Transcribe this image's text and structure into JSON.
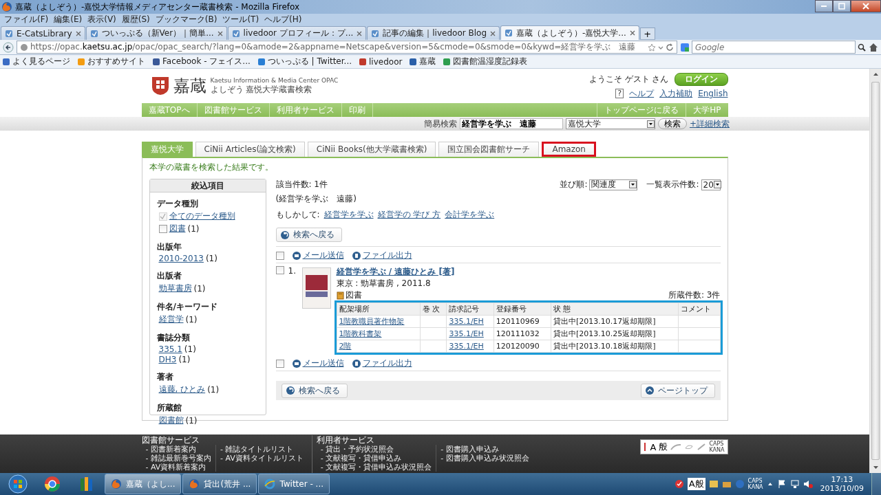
{
  "browser": {
    "title": "嘉蔵（よしぞう）-嘉悦大学情報メディアセンター蔵書検索 - Mozilla Firefox",
    "menu": [
      "ファイル(F)",
      "編集(E)",
      "表示(V)",
      "履歴(S)",
      "ブックマーク(B)",
      "ツール(T)",
      "ヘルプ(H)"
    ],
    "tabs": [
      {
        "label": "E-CatsLibrary",
        "selected": false
      },
      {
        "label": "ついっぷる（新Ver）｜簡単...",
        "selected": false
      },
      {
        "label": "livedoor プロフィール：プ...",
        "selected": false
      },
      {
        "label": "記事の編集｜livedoor Blog",
        "selected": false
      },
      {
        "label": "嘉蔵（よしぞう）-嘉悦大学...",
        "selected": true
      }
    ],
    "new_tab": "+",
    "url_prefix": "https://opac.",
    "url_domain": "kaetsu.ac.jp",
    "url_rest": "/opac/opac_search/?lang=0&amode=2&appname=Netscape&version=5&cmode=0&smode=0&kywd=経営学を学ぶ　遠藤",
    "search_placeholder": "Google",
    "bookmarks": [
      "よく見るページ",
      "おすすめサイト",
      "Facebook - フェイス...",
      "ついっぷる | Twitter...",
      "livedoor",
      "嘉蔵",
      "図書館温湿度記録表"
    ]
  },
  "site": {
    "logo": "嘉蔵",
    "subtitle_en": "Kaetsu Information & Media Center OPAC",
    "subtitle": "よしぞう 嘉悦大学蔵書検索",
    "welcome": "ようこそ ゲスト さん",
    "login": "ログイン",
    "help_icon": "?",
    "links": [
      "ヘルプ",
      "入力補助",
      "English"
    ],
    "nav_left": [
      "嘉蔵TOPへ",
      "図書館サービス",
      "利用者サービス",
      "印刷"
    ],
    "nav_right": [
      "トップページに戻る",
      "大学HP"
    ],
    "quick_search": {
      "label": "簡易検索",
      "value": "経営学を学ぶ　遠藤",
      "scope": "嘉悦大学",
      "button": "検索",
      "advanced": "+詳細検索"
    },
    "source_tabs": [
      {
        "label": "嘉悦大学",
        "selected": true,
        "highlighted": false
      },
      {
        "label": "CiNii Articles(論文検索)",
        "selected": false,
        "highlighted": false
      },
      {
        "label": "CiNii Books(他大学蔵書検索)",
        "selected": false,
        "highlighted": false
      },
      {
        "label": "国立国会図書館サーチ",
        "selected": false,
        "highlighted": false
      },
      {
        "label": "Amazon",
        "selected": false,
        "highlighted": true
      }
    ],
    "intro": "本学の蔵書を検索した結果です。",
    "facets": {
      "title": "絞込項目",
      "groups": [
        {
          "heading": "データ種別",
          "items": [
            {
              "kind": "checkbox",
              "label": "全てのデータ種別",
              "checked": true,
              "disabled": true
            },
            {
              "kind": "checkbox",
              "label": "図書",
              "count": "(1)",
              "checked": false,
              "disabled": false
            }
          ]
        },
        {
          "heading": "出版年",
          "items": [
            {
              "kind": "link",
              "label": "2010-2013",
              "count": "(1)"
            }
          ]
        },
        {
          "heading": "出版者",
          "items": [
            {
              "kind": "link",
              "label": "勁草書房",
              "count": "(1)"
            }
          ]
        },
        {
          "heading": "件名/キーワード",
          "items": [
            {
              "kind": "link",
              "label": "経営学",
              "count": "(1)"
            }
          ]
        },
        {
          "heading": "書誌分類",
          "items": [
            {
              "kind": "link",
              "label": "335.1",
              "count": "(1)"
            },
            {
              "kind": "link",
              "label": "DH3",
              "count": "(1)"
            }
          ]
        },
        {
          "heading": "著者",
          "items": [
            {
              "kind": "link",
              "label": "遠藤, ひとみ",
              "count": "(1)"
            }
          ]
        },
        {
          "heading": "所蔵館",
          "items": [
            {
              "kind": "link",
              "label": "図書館",
              "count": "(1)"
            }
          ]
        }
      ]
    },
    "results": {
      "count": "該当件数: 1件",
      "query": "(経営学を学ぶ　遠藤)",
      "suggest_label": "もしかして:",
      "suggestions": [
        "経営学を学ぶ",
        "経営学の 学び 方",
        "会計学を学ぶ"
      ],
      "sort_label": "並び順:",
      "sort": "関連度",
      "per_page_label": "一覧表示件数:",
      "per_page": "20",
      "back_top": "検索へ戻る",
      "back_bottom": "検索へ戻る",
      "page_top": "ページトップ",
      "actions": [
        {
          "checked": false,
          "mail": "メール送信",
          "file": "ファイル出力"
        },
        {
          "checked": false,
          "mail": "メール送信",
          "file": "ファイル出力"
        }
      ],
      "items": [
        {
          "number": "1.",
          "checked": false,
          "title": "経営学を学ぶ / 遠藤ひとみ [著]",
          "imprint": "東京 : 勁草書房 , 2011.8",
          "type": "図書",
          "holdings_count": "所蔵件数: 3件",
          "highlighted": true,
          "columns": [
            {
              "label": "配架場所",
              "kind": "link"
            },
            {
              "label": "巻 次"
            },
            {
              "label": "請求記号",
              "kind": "link"
            },
            {
              "label": "登録番号",
              "kind": "text"
            },
            {
              "label": "状 態",
              "kind": "text"
            },
            {
              "label": "コメント"
            }
          ],
          "rows": [
            [
              "1階教職員著作物架",
              null,
              "335.1/EH",
              "120110969",
              "貸出中[2013.10.17返却期限]",
              null
            ],
            [
              "1階教科書架",
              null,
              "335.1/EH",
              "120111032",
              "貸出中[2013.10.25返却期限]",
              null
            ],
            [
              "2階",
              null,
              "335.1/EH",
              "120120090",
              "貸出中[2013.10.18返却期限]",
              null
            ]
          ]
        }
      ]
    },
    "footer": {
      "sections": [
        {
          "title": "図書館サービス",
          "columns": [
            [
              "- 図書新着案内",
              "- 雑誌最新巻号案内",
              "- AV資料新着案内"
            ],
            [
              "- 雑誌タイトルリスト",
              "- AV資料タイトルリスト"
            ]
          ]
        },
        {
          "title": "利用者サービス",
          "columns": [
            [
              "- 貸出・予約状況照会",
              "- 文献複写・貸借申込み",
              "- 文献複写・貸借申込み状況照会"
            ],
            [
              "- 図書購入申込み",
              "- 図書購入申込み状況照会"
            ]
          ]
        }
      ],
      "ime": {
        "mode": "A",
        "input": "般",
        "caps": "CAPS",
        "kana": "KANA"
      }
    }
  },
  "taskbar": {
    "windows": [
      {
        "label": "嘉蔵（よし...",
        "selected": true,
        "kind": "firefox"
      },
      {
        "label": "貸出(荒井 ...",
        "selected": false,
        "kind": "firefox"
      },
      {
        "label": "Twitter - ...",
        "selected": false,
        "kind": "ie"
      }
    ],
    "ime": "A般",
    "caps": "CAPS",
    "kana": "KANA",
    "time": "17:13",
    "date": "2013/10/09"
  }
}
